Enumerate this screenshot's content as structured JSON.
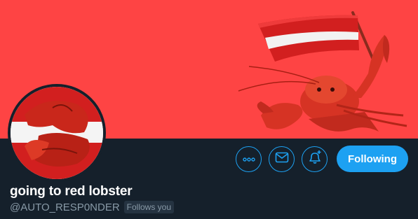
{
  "profile": {
    "display_name": "going to red lobster",
    "handle": "@AUTO_RESP0NDER",
    "follows_you_badge": "Follows you"
  },
  "actions": {
    "more_icon": "more-horizontal-icon",
    "message_icon": "envelope-icon",
    "notify_icon": "bell-plus-icon",
    "follow_label": "Following"
  },
  "colors": {
    "banner_bg": "#fe4444",
    "page_bg": "#15202b",
    "accent": "#1da1f2"
  }
}
